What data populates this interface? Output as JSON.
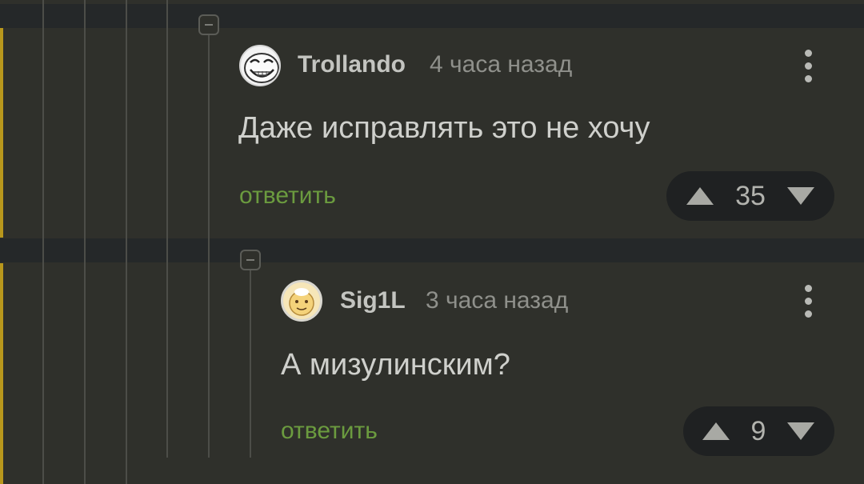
{
  "comments": [
    {
      "username": "Trollando",
      "timestamp": "4 часа назад",
      "text": "Даже исправлять это не хочу",
      "reply_label": "ответить",
      "votes": "35",
      "avatar_icon": "trollface-avatar"
    },
    {
      "username": "Sig1L",
      "timestamp": "3 часа назад",
      "text": "А мизулинским?",
      "reply_label": "ответить",
      "votes": "9",
      "avatar_icon": "cartoon-avatar"
    }
  ],
  "colors": {
    "background": "#2f302b",
    "separator": "#252829",
    "accent": "#b8971c",
    "reply_link": "#6b9b3f",
    "vote_pill": "#1f2122"
  }
}
